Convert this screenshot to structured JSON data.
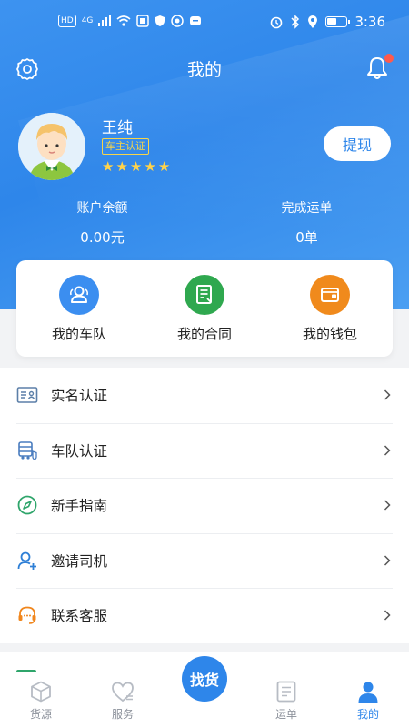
{
  "status_bar": {
    "left_chips": [
      "HD",
      "4G"
    ],
    "time": "3:36"
  },
  "nav": {
    "title": "我的",
    "settings_icon": "gear-icon",
    "bell_icon": "bell-icon",
    "notification_dot_color": "#ff5a4d"
  },
  "profile": {
    "name": "王纯",
    "badge": "车主认证",
    "stars": 5,
    "withdraw_label": "提现"
  },
  "stats": [
    {
      "label": "账户余额",
      "value": "0.00元"
    },
    {
      "label": "完成运单",
      "value": "0单"
    }
  ],
  "quick_actions": [
    {
      "label": "我的车队",
      "icon": "team-icon",
      "color": "#3b8ef0"
    },
    {
      "label": "我的合同",
      "icon": "contract-icon",
      "color": "#2fa84f"
    },
    {
      "label": "我的钱包",
      "icon": "wallet-icon",
      "color": "#f08a1c"
    }
  ],
  "menu": [
    {
      "label": "实名认证",
      "icon": "id-card-icon"
    },
    {
      "label": "车队认证",
      "icon": "truck-icon"
    },
    {
      "label": "新手指南",
      "icon": "compass-icon"
    },
    {
      "label": "邀请司机",
      "icon": "add-user-icon"
    },
    {
      "label": "联系客服",
      "icon": "headset-icon"
    }
  ],
  "tabs": [
    {
      "label": "货源",
      "icon": "box-icon"
    },
    {
      "label": "服务",
      "icon": "heart-icon"
    },
    {
      "label": "找货",
      "icon": "find-goods-button"
    },
    {
      "label": "运单",
      "icon": "list-icon"
    },
    {
      "label": "我的",
      "icon": "person-icon",
      "active": true
    }
  ],
  "colors": {
    "primary": "#2e86ea",
    "star": "#ffd34a"
  }
}
